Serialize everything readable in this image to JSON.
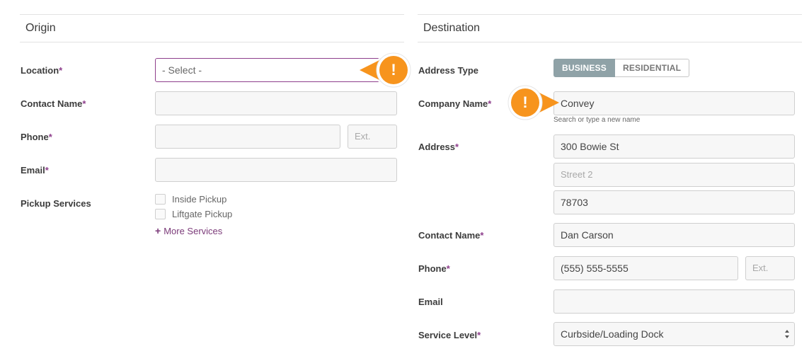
{
  "origin": {
    "title": "Origin",
    "location_label": "Location",
    "location_value": "- Select -",
    "contact_name_label": "Contact Name",
    "phone_label": "Phone",
    "ext_placeholder": "Ext.",
    "email_label": "Email",
    "pickup_services_label": "Pickup Services",
    "services": [
      "Inside Pickup",
      "Liftgate Pickup"
    ],
    "more_services_label": "More Services"
  },
  "destination": {
    "title": "Destination",
    "address_type_label": "Address Type",
    "address_type_options": [
      "BUSINESS",
      "RESIDENTIAL"
    ],
    "address_type_selected": "BUSINESS",
    "company_name_label": "Company Name",
    "company_name_value": "Convey",
    "company_name_help": "Search or type a new name",
    "address_label": "Address",
    "address_line1": "300 Bowie St",
    "address_line2_placeholder": "Street 2",
    "address_zip": "78703",
    "contact_name_label": "Contact Name",
    "contact_name_value": "Dan Carson",
    "phone_label": "Phone",
    "phone_value": "(555) 555-5555",
    "ext_placeholder": "Ext.",
    "email_label": "Email",
    "service_level_label": "Service Level",
    "service_level_value": "Curbside/Loading Dock"
  },
  "required_marker": "*",
  "alert_icon_glyph": "!",
  "colors": {
    "accent_purple": "#8e3f8c",
    "alert_orange": "#f7941d",
    "toggle_active": "#8fa2a7"
  }
}
